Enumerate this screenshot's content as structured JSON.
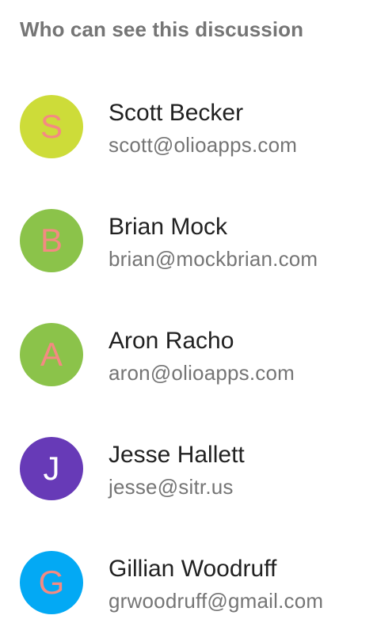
{
  "title": "Who can see this discussion",
  "members": [
    {
      "initial": "S",
      "name": "Scott Becker",
      "email": "scott@olioapps.com",
      "avatar_bg": "#cddc39",
      "initial_color": "#f48a82"
    },
    {
      "initial": "B",
      "name": "Brian Mock",
      "email": "brian@mockbrian.com",
      "avatar_bg": "#8bc34a",
      "initial_color": "#f48a82"
    },
    {
      "initial": "A",
      "name": "Aron Racho",
      "email": "aron@olioapps.com",
      "avatar_bg": "#8bc34a",
      "initial_color": "#f48a82"
    },
    {
      "initial": "J",
      "name": "Jesse Hallett",
      "email": "jesse@sitr.us",
      "avatar_bg": "#673ab7",
      "initial_color": "#ffffff"
    },
    {
      "initial": "G",
      "name": "Gillian Woodruff",
      "email": "grwoodruff@gmail.com",
      "avatar_bg": "#03a9f4",
      "initial_color": "#f48a82"
    }
  ]
}
